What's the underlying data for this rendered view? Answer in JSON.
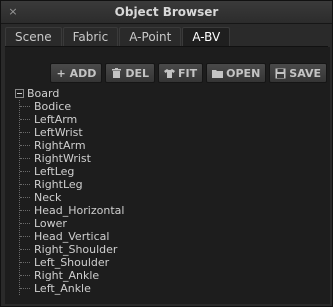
{
  "window": {
    "title": "Object Browser",
    "close_glyph": "×"
  },
  "tabs": [
    {
      "label": "Scene",
      "active": false
    },
    {
      "label": "Fabric",
      "active": false
    },
    {
      "label": "A-Point",
      "active": false
    },
    {
      "label": "A-BV",
      "active": true
    }
  ],
  "toolbar": {
    "add": {
      "label": "ADD",
      "icon": "plus-icon"
    },
    "del": {
      "label": "DEL",
      "icon": "trash-icon"
    },
    "fit": {
      "label": "FIT",
      "icon": "shirt-icon"
    },
    "open": {
      "label": "OPEN",
      "icon": "folder-icon"
    },
    "save": {
      "label": "SAVE",
      "icon": "floppy-icon"
    }
  },
  "tree": {
    "root": "Board",
    "children": [
      "Bodice",
      "LeftArm",
      "LeftWrist",
      "RightArm",
      "RightWrist",
      "LeftLeg",
      "RightLeg",
      "Neck",
      "Head_Horizontal",
      "Lower",
      "Head_Vertical",
      "Right_Shoulder",
      "Left_Shoulder",
      "Right_Ankle",
      "Left_Ankle"
    ]
  }
}
